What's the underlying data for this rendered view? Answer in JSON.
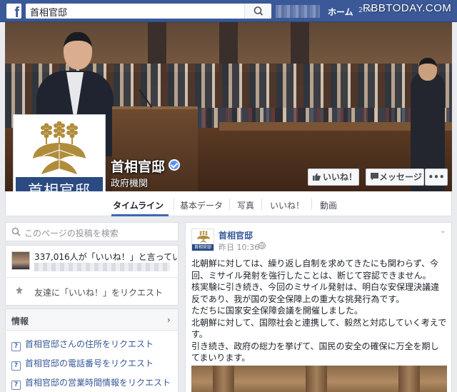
{
  "topbar": {
    "logo_letter": "f",
    "search_value": "首相官邸",
    "nav_home": "ホーム",
    "nav_extra": "20+",
    "watermark": "RBBTODAY.COM"
  },
  "page": {
    "name": "首相官邸",
    "category": "政府機関",
    "profile_label": "首相官邸",
    "like_button": "いいね！",
    "message_button": "メッセージ",
    "more_button": "•••"
  },
  "tabs": [
    {
      "label": "タイムライン"
    },
    {
      "label": "基本データ"
    },
    {
      "label": "写真"
    },
    {
      "label": "いいね！"
    },
    {
      "label": "動画"
    }
  ],
  "left": {
    "search_placeholder": "このページの投稿を検索",
    "likes_text": "337,016人が「いいね！」と言ってい…",
    "invite_text": "友達に「いいね！」をリクエスト",
    "info_title": "情報",
    "info_chevron": "›",
    "info_items": [
      "首相官邸さんの住所をリクエスト",
      "首相官邸の電話番号をリクエスト",
      "首相官邸の営業時間情報をリクエスト"
    ],
    "info_icon_glyph": "?"
  },
  "post": {
    "author": "首相官邸",
    "avatar_label": "首相官邸",
    "time": "昨日 10:36 ·",
    "menu": "⌄",
    "paragraphs": [
      "北朝鮮に対しては、繰り返し自制を求めてきたにも関わらず、今回、ミサイル発射を強行したことは、断じて容認できません。",
      "核実験に引き続き、今回のミサイル発射は、明白な安保理決議違反であり、我が国の安全保障上の重大な挑発行為です。",
      "ただちに国家安全保障会議を開催しました。",
      "北朝鮮に対して、国際社会と連携して、毅然と対応していく考えです。",
      "引き続き、政府の総力を挙げて、国民の安全の確保に万全を期してまいります。"
    ]
  },
  "colors": {
    "brand": "#3b5998",
    "link": "#365899",
    "profile_band": "#2b4a82",
    "emblem_gold": "#b08d3c"
  },
  "icons": {
    "logo": "facebook-logo-icon",
    "search": "search-icon",
    "verified": "verified-badge-icon",
    "like": "thumbs-up-icon",
    "message": "message-icon",
    "invite": "invite-icon",
    "info": "question-icon",
    "globe": "globe-icon"
  }
}
